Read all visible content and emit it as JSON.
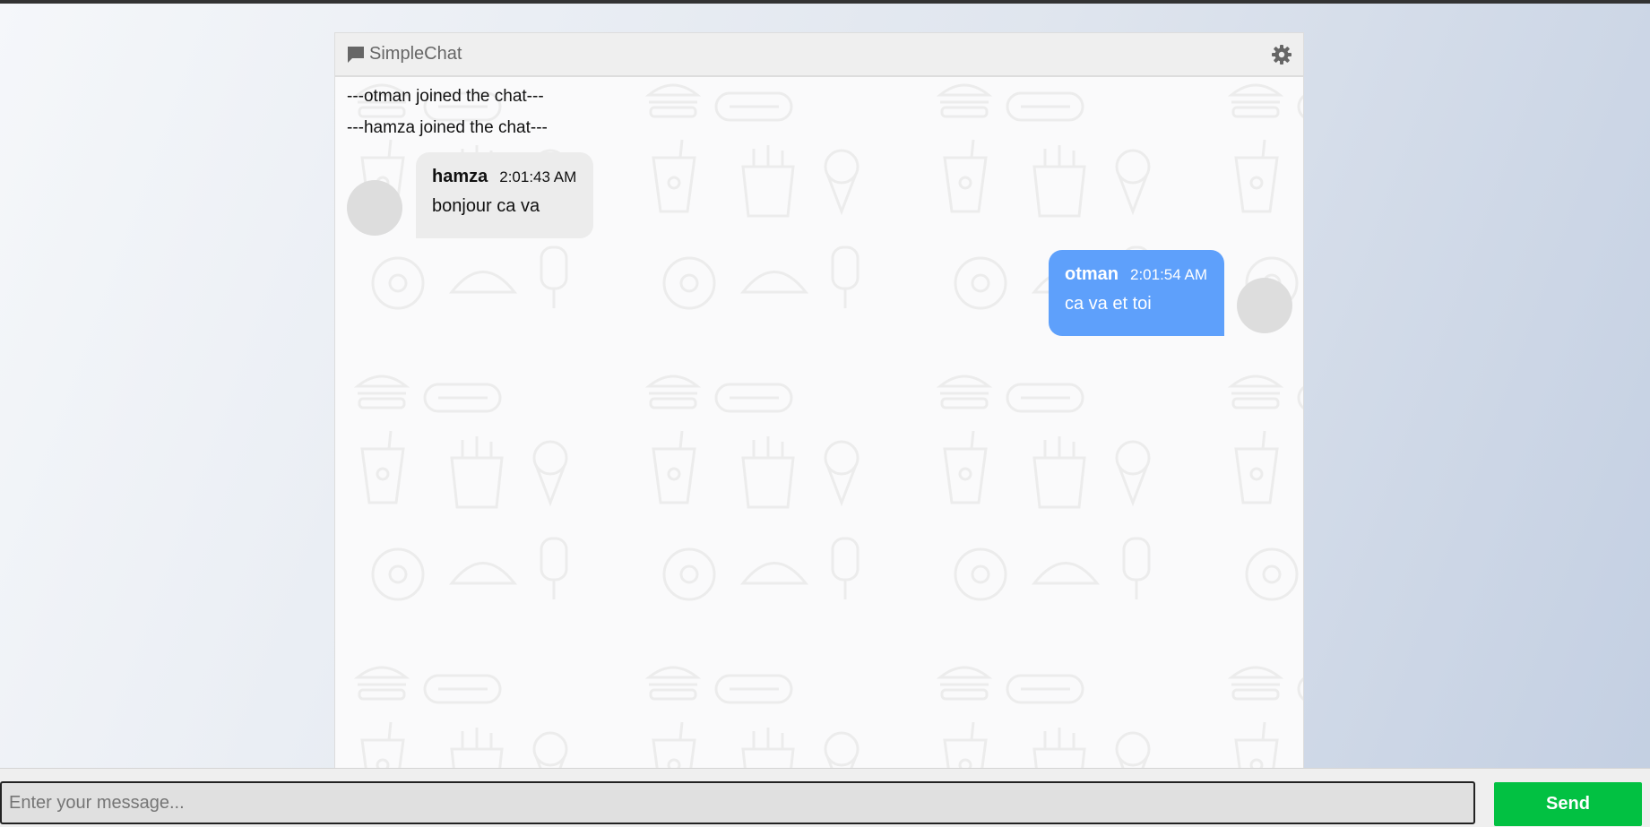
{
  "header": {
    "title": "SimpleChat",
    "brand_icon": "chat-bubble-icon",
    "settings_icon": "gear-icon"
  },
  "system_messages": [
    "---otman joined the chat---",
    "---hamza joined the chat---"
  ],
  "messages": [
    {
      "user": "hamza",
      "time": "2:01:43 AM",
      "text": "bonjour ca va",
      "side": "left"
    },
    {
      "user": "otman",
      "time": "2:01:54 AM",
      "text": "ca va et toi",
      "side": "right"
    }
  ],
  "composer": {
    "placeholder": "Enter your message...",
    "send_label": "Send"
  },
  "colors": {
    "own_bubble": "#5ea0fb",
    "other_bubble": "#ececec",
    "send_button": "#02c142"
  }
}
